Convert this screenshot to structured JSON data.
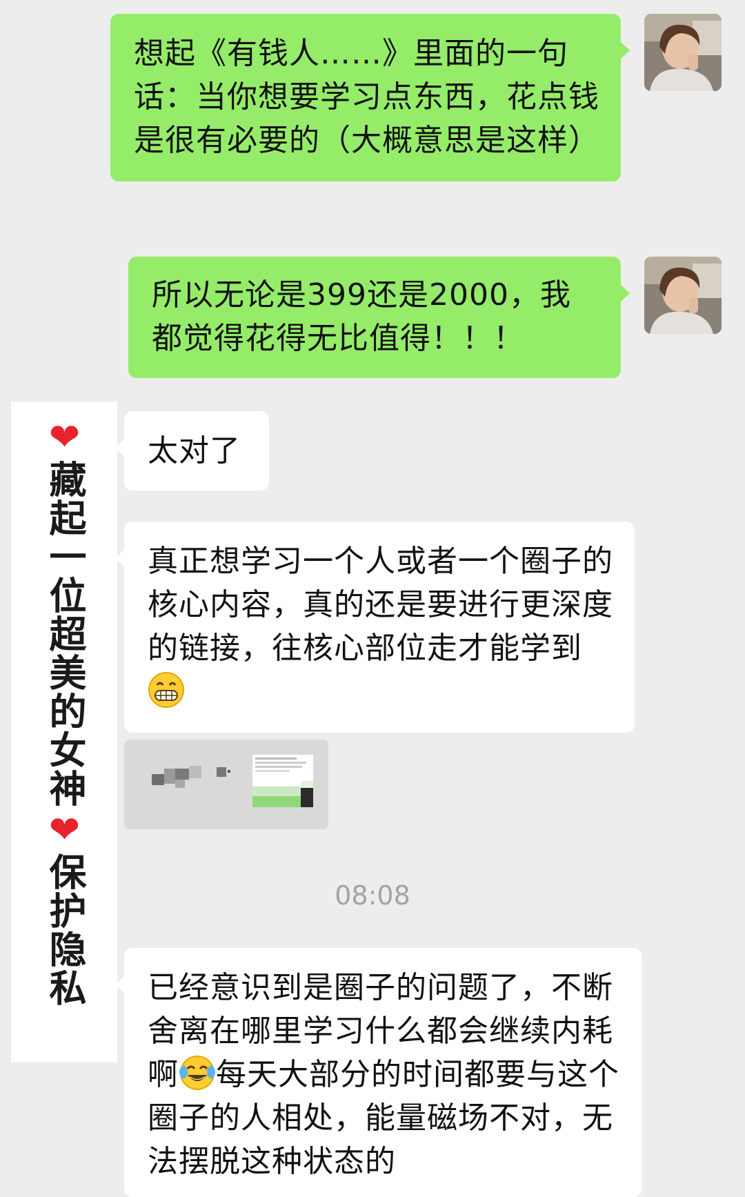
{
  "messages": [
    {
      "side": "out",
      "text": "想起《有钱人……》里面的一句话：当你想要学习点东西，花点钱是很有必要的（大概意思是这样）"
    },
    {
      "side": "out",
      "text": "所以无论是399还是2000，我都觉得花得无比值得！！！"
    },
    {
      "side": "in",
      "text": "太对了"
    },
    {
      "side": "in",
      "text": "真正想学习一个人或者一个圈子的核心内容，真的还是要进行更深度的链接，往核心部位走才能学到",
      "emoji": "grin-emoji"
    },
    {
      "side": "in",
      "type": "image-card",
      "content": "blurred-shared-image"
    },
    {
      "side": "in",
      "text_part1": "已经意识到是圈子的问题了，不断舍离在哪里学习什么都会继续内耗啊",
      "emoji": "tears-of-joy-emoji",
      "text_part2": "每天大部分的时间都要与这个圈子的人相处，能量磁场不对，无法摆脱这种状态的"
    }
  ],
  "timestamp": "08:08",
  "privacy_banner": {
    "heart": "❤",
    "line1": "藏起一位超美的女神",
    "line2": "保护隐私"
  },
  "colors": {
    "background": "#ededed",
    "outgoing_bubble": "#95ec69",
    "incoming_bubble": "#ffffff",
    "timestamp": "#a3a3a3",
    "heart": "#e8232c"
  }
}
